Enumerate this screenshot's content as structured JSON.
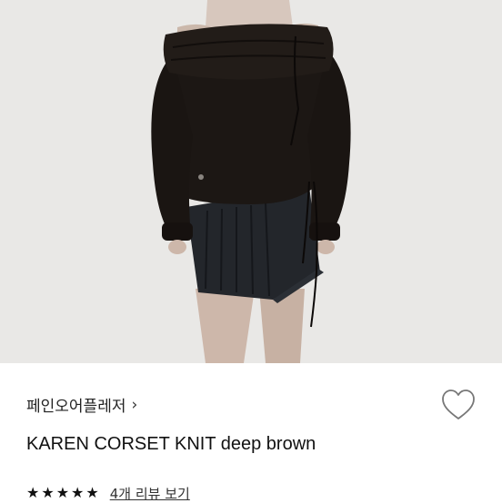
{
  "product": {
    "brand": "페인오어플레저",
    "name": "KAREN CORSET KNIT deep brown"
  },
  "icons": {
    "brand_chevron": "chevron-right-icon",
    "wishlist": "heart-outline-icon",
    "star": "star-filled-icon"
  },
  "rating": {
    "stars": 5,
    "review_link": "4개 리뷰 보기"
  },
  "colors": {
    "background": "#ffffff",
    "photo_bg": "#e9e8e6",
    "knit": "#1c1714",
    "skirt": "#23262b",
    "text": "#111111"
  }
}
